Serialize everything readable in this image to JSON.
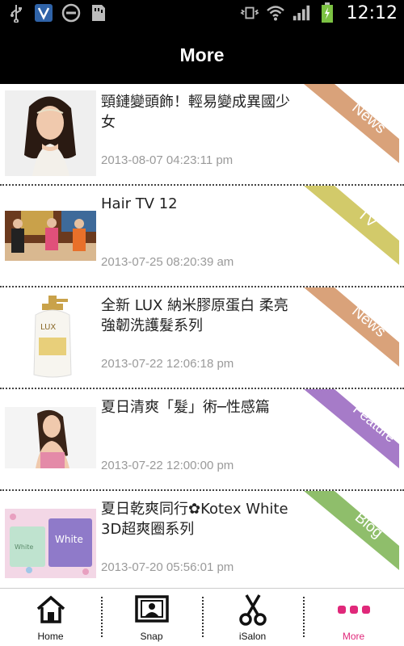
{
  "status_bar": {
    "time": "12:12",
    "left_icons": [
      "usb-icon",
      "shield-icon",
      "do-not-disturb-icon",
      "sd-card-icon"
    ],
    "right_icons": [
      "vibrate-icon",
      "wifi-icon",
      "signal-icon",
      "battery-charging-icon"
    ]
  },
  "header": {
    "title": "More"
  },
  "articles": [
    {
      "title": "頸鏈變頭飾！輕易變成異國少女",
      "date": "2013-08-07 04:23:11 pm",
      "tag": "News",
      "tag_color": "#d9a27a"
    },
    {
      "title": "Hair TV 12",
      "date": "2013-07-25 08:20:39 am",
      "tag": "TV",
      "tag_color": "#d2ca6a"
    },
    {
      "title": "全新 LUX 納米膠原蛋白  柔亮強韌洗護髮系列",
      "date": "2013-07-22 12:06:18 pm",
      "tag": "News",
      "tag_color": "#d9a27a"
    },
    {
      "title": "夏日清爽「髮」術─性感篇",
      "date": "2013-07-22 12:00:00 pm",
      "tag": "Feature",
      "tag_color": "#a67bc8"
    },
    {
      "title": "夏日乾爽同行✿Kotex White 3D超爽圈系列",
      "date": "2013-07-20 05:56:01 pm",
      "tag": "Blog",
      "tag_color": "#8fbe6b"
    }
  ],
  "bottom_nav": {
    "items": [
      {
        "label": "Home",
        "icon": "home-icon",
        "active": false
      },
      {
        "label": "Snap",
        "icon": "picture-frame-icon",
        "active": false
      },
      {
        "label": "iSalon",
        "icon": "scissors-icon",
        "active": false
      },
      {
        "label": "More",
        "icon": "more-dots-icon",
        "active": true
      }
    ],
    "active_color": "#e0287a"
  }
}
